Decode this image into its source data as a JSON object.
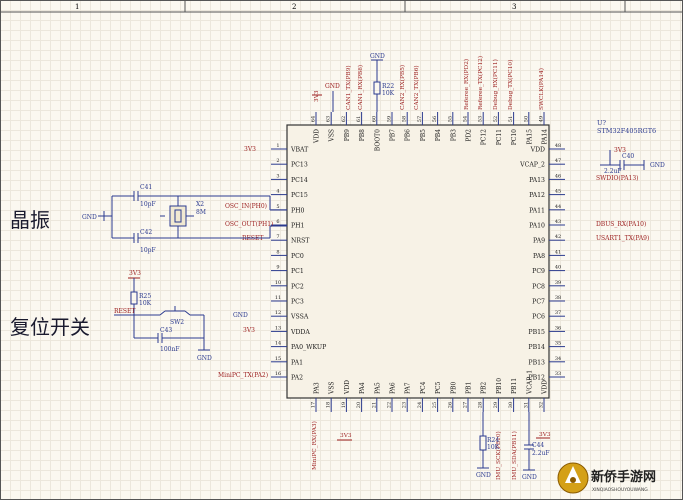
{
  "border": {
    "zones": [
      "1",
      "2",
      "3"
    ]
  },
  "section_labels": {
    "crystal": "晶振",
    "reset": "复位开关"
  },
  "chip": {
    "ref": "U?",
    "part": "STM32F405RGT6",
    "left_pins": [
      {
        "name": "VBAT",
        "num": "1"
      },
      {
        "name": "PC13",
        "num": "2"
      },
      {
        "name": "PC14",
        "num": "3"
      },
      {
        "name": "PC15",
        "num": "4"
      },
      {
        "name": "PH0",
        "num": "5"
      },
      {
        "name": "PH1",
        "num": "6"
      },
      {
        "name": "NRST",
        "num": "7"
      },
      {
        "name": "PC0",
        "num": "8"
      },
      {
        "name": "PC1",
        "num": "9"
      },
      {
        "name": "PC2",
        "num": "10"
      },
      {
        "name": "PC3",
        "num": "11"
      },
      {
        "name": "VSSA",
        "num": "12"
      },
      {
        "name": "VDDA",
        "num": "13"
      },
      {
        "name": "PA0_WKUP",
        "num": "14"
      },
      {
        "name": "PA1",
        "num": "15"
      },
      {
        "name": "PA2",
        "num": "16"
      }
    ],
    "right_pins": [
      {
        "name": "VDD",
        "num": "48"
      },
      {
        "name": "VCAP_2",
        "num": "47"
      },
      {
        "name": "PA13",
        "num": "46"
      },
      {
        "name": "PA12",
        "num": "45"
      },
      {
        "name": "PA11",
        "num": "44"
      },
      {
        "name": "PA10",
        "num": "43"
      },
      {
        "name": "PA9",
        "num": "42"
      },
      {
        "name": "PA8",
        "num": "41"
      },
      {
        "name": "PC9",
        "num": "40"
      },
      {
        "name": "PC8",
        "num": "39"
      },
      {
        "name": "PC7",
        "num": "38"
      },
      {
        "name": "PC6",
        "num": "37"
      },
      {
        "name": "PB15",
        "num": "36"
      },
      {
        "name": "PB14",
        "num": "35"
      },
      {
        "name": "PB13",
        "num": "34"
      },
      {
        "name": "PB12",
        "num": "33"
      }
    ],
    "top_pins": [
      {
        "name": "VDD",
        "num": "64"
      },
      {
        "name": "VSS",
        "num": "63"
      },
      {
        "name": "PB9",
        "num": "62"
      },
      {
        "name": "PB8",
        "num": "61"
      },
      {
        "name": "BOOT0",
        "num": "60"
      },
      {
        "name": "PB7",
        "num": "59"
      },
      {
        "name": "PB6",
        "num": "58"
      },
      {
        "name": "PB5",
        "num": "57"
      },
      {
        "name": "PB4",
        "num": "56"
      },
      {
        "name": "PB3",
        "num": "55"
      },
      {
        "name": "PD2",
        "num": "54"
      },
      {
        "name": "PC12",
        "num": "53"
      },
      {
        "name": "PC11",
        "num": "52"
      },
      {
        "name": "PC10",
        "num": "51"
      },
      {
        "name": "PA15",
        "num": "50"
      },
      {
        "name": "PA14",
        "num": "49"
      }
    ],
    "bottom_pins": [
      {
        "name": "PA3",
        "num": "17"
      },
      {
        "name": "VSS",
        "num": "18"
      },
      {
        "name": "VDD",
        "num": "19"
      },
      {
        "name": "PA4",
        "num": "20"
      },
      {
        "name": "PA5",
        "num": "21"
      },
      {
        "name": "PA6",
        "num": "22"
      },
      {
        "name": "PA7",
        "num": "23"
      },
      {
        "name": "PC4",
        "num": "24"
      },
      {
        "name": "PC5",
        "num": "25"
      },
      {
        "name": "PB0",
        "num": "26"
      },
      {
        "name": "PB1",
        "num": "27"
      },
      {
        "name": "PB2",
        "num": "28"
      },
      {
        "name": "PB10",
        "num": "29"
      },
      {
        "name": "PB11",
        "num": "30"
      },
      {
        "name": "VCAP_1",
        "num": "31"
      },
      {
        "name": "VDD",
        "num": "32"
      }
    ]
  },
  "nets": {
    "top": [
      "3V3",
      "GND",
      "CAN1_TX(PB9)",
      "CAN1_RX(PB8)",
      "CAN2_RX(PB5)",
      "CAN2_TX(PB6)",
      "Referee_RX(PD2)",
      "Referee_TX(PC12)",
      "Debug_RX(PC11)",
      "Debug_TX(PC10)",
      "SWCLK(PA14)"
    ],
    "left": {
      "vbat": "3V3",
      "osc_in": "OSC_IN(PH0)",
      "osc_out": "OSC_OUT(PH1)",
      "reset": "RESET",
      "vssa": "GND",
      "vdda": "3V3",
      "pa2": "MiniPC_TX(PA2)"
    },
    "right": {
      "vdd": "3V3",
      "gnd": "GND",
      "swdio": "SWDIO(PA13)",
      "dbus": "DBUS_RX(PA10)",
      "usart1": "USART1_TX(PA9)"
    },
    "bottom": {
      "pa3": "MiniPC_RX(PA3)",
      "vdd": "3V3",
      "pb10": "IMU_SCK(PB10)",
      "pb11": "IMU_SDA(PB11)",
      "vdd2": "3V3"
    }
  },
  "components": {
    "c41": {
      "ref": "C41",
      "value": "10pF"
    },
    "c42": {
      "ref": "C42",
      "value": "10pF"
    },
    "x2": {
      "ref": "X2",
      "value": "8M"
    },
    "r22": {
      "ref": "R22",
      "value": "10K"
    },
    "r25": {
      "ref": "R25",
      "value": "10K"
    },
    "sw2": {
      "ref": "SW2"
    },
    "c43": {
      "ref": "C43",
      "value": "100nF"
    },
    "c40": {
      "ref": "C40",
      "value": "2.2uF"
    },
    "r24": {
      "ref": "R24",
      "value": "10K"
    },
    "c44": {
      "ref": "C44",
      "value": "2.2uF"
    }
  },
  "power": {
    "gnd": "GND",
    "v33": "3V3"
  },
  "watermark": {
    "text": "新侨手游网",
    "sub": "XINQIAOSHOUYOUWANG"
  },
  "colors": {
    "wire": "#2b3a8f",
    "net": "#9b1c1c",
    "body": "#f7f2e6",
    "edge": "#333333"
  }
}
